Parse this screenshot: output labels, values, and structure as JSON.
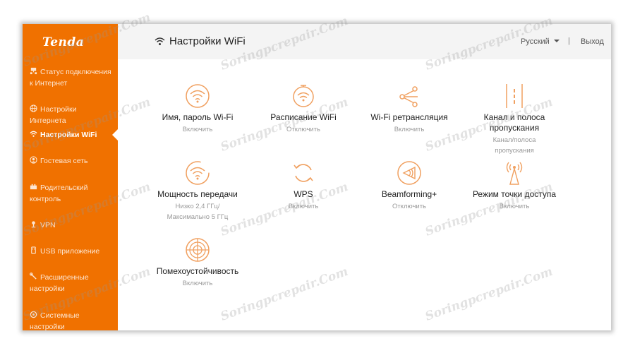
{
  "brand": {
    "logo_text": "Tenda"
  },
  "sidebar": {
    "items": [
      {
        "label": "Статус подключения к Интернет",
        "icon": "network-status-icon",
        "active": false
      },
      {
        "label": "Настройки Интернета",
        "icon": "globe-icon",
        "active": false
      },
      {
        "label": "Настройки WiFi",
        "icon": "wifi-icon",
        "active": true
      },
      {
        "label": "Гостевая сеть",
        "icon": "guest-network-icon",
        "active": false
      },
      {
        "label": "Родительский контроль",
        "icon": "parental-control-icon",
        "active": false
      },
      {
        "label": "VPN",
        "icon": "vpn-icon",
        "active": false
      },
      {
        "label": "USB приложение",
        "icon": "usb-icon",
        "active": false
      },
      {
        "label": "Расширенные настройки",
        "icon": "tools-icon",
        "active": false
      },
      {
        "label": "Системные настройки",
        "icon": "system-settings-icon",
        "active": false
      }
    ]
  },
  "header": {
    "title": "Настройки WiFi",
    "language": "Русский",
    "separator": "|",
    "logout": "Выход"
  },
  "tiles": [
    {
      "title": "Имя, пароль Wi-Fi",
      "status": "Включить",
      "icon": "wifi-circle-icon"
    },
    {
      "title": "Расписание WiFi",
      "status": "Отключить",
      "icon": "wifi-schedule-icon"
    },
    {
      "title": "Wi-Fi ретрансляция",
      "status": "Включить",
      "icon": "wifi-repeater-icon"
    },
    {
      "title": "Канал и полоса пропускания",
      "status": "Канал/полоса пропускания",
      "icon": "channel-bandwidth-icon"
    },
    {
      "title": "Мощность передачи",
      "status": "Низко 2,4 ГГц/ Максимально 5 ГГц",
      "icon": "transmit-power-icon"
    },
    {
      "title": "WPS",
      "status": "Включить",
      "icon": "wps-icon"
    },
    {
      "title": "Beamforming+",
      "status": "Отключить",
      "icon": "beamforming-icon"
    },
    {
      "title": "Режим точки доступа",
      "status": "Включить",
      "icon": "access-point-icon"
    },
    {
      "title": "Помехоустойчивость",
      "status": "Включить",
      "icon": "interference-icon"
    }
  ],
  "watermark": "Soringpcrepair.Com",
  "colors": {
    "accent": "#f07100",
    "icon": "#f0a060",
    "header_bg": "#f4f4f4"
  }
}
